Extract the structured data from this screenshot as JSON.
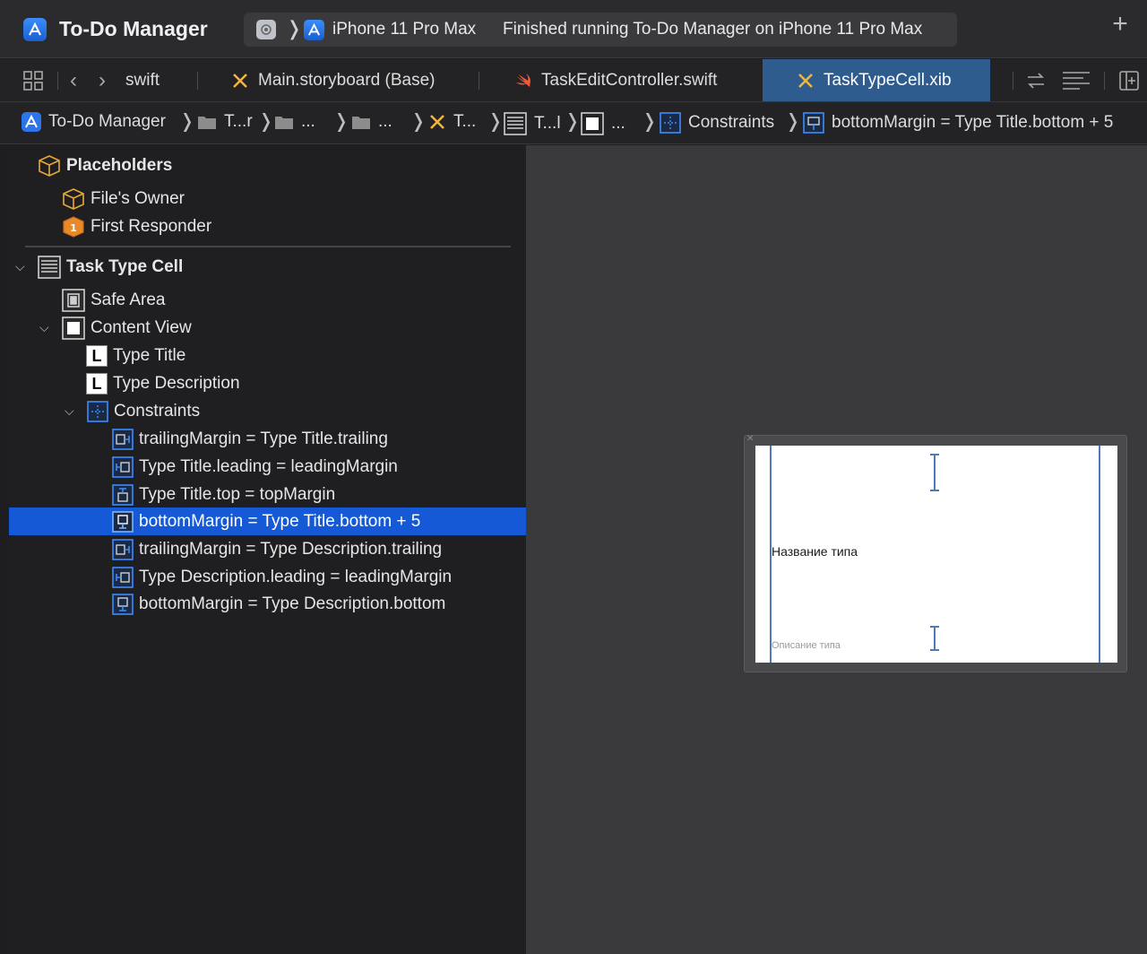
{
  "window": {
    "app_title": "To-Do Manager",
    "destination": "iPhone 11 Pro Max",
    "status": "Finished running To-Do Manager on iPhone 11 Pro Max",
    "add_icon": "plus-icon"
  },
  "tabs": [
    {
      "label": "swift",
      "active": false
    },
    {
      "label": "Main.storyboard (Base)",
      "active": false
    },
    {
      "label": "TaskEditController.swift",
      "active": false
    },
    {
      "label": "TaskTypeCell.xib",
      "active": true
    }
  ],
  "jumpbar": {
    "items": [
      {
        "label": "To-Do Manager",
        "icon": "app-icon"
      },
      {
        "label": "T...r",
        "icon": "folder-icon"
      },
      {
        "label": "...",
        "icon": "folder-icon"
      },
      {
        "label": "...",
        "icon": "folder-icon"
      },
      {
        "label": "T...",
        "icon": "xib-icon"
      },
      {
        "label": "T...l",
        "icon": "table-cell-icon"
      },
      {
        "label": "...",
        "icon": "view-icon"
      },
      {
        "label": "Constraints",
        "icon": "constraints-icon"
      },
      {
        "label": "bottomMargin = Type Title.bottom + 5",
        "icon": "constraint-icon"
      }
    ]
  },
  "outline": {
    "placeholders": "Placeholders",
    "files_owner": "File's Owner",
    "first_responder": "First Responder",
    "cell": "Task Type Cell",
    "safe_area": "Safe Area",
    "content_view": "Content View",
    "type_title": "Type Title",
    "type_description": "Type Description",
    "constraints": "Constraints",
    "constraint_items": [
      "trailingMargin = Type Title.trailing",
      "Type Title.leading = leadingMargin",
      "Type Title.top = topMargin",
      "bottomMargin = Type Title.bottom + 5",
      "trailingMargin = Type Description.trailing",
      "Type Description.leading = leadingMargin",
      "bottomMargin = Type Description.bottom"
    ],
    "selected_index": 3
  },
  "canvas": {
    "title_label": "Название типа",
    "description_label": "Описание типа"
  }
}
